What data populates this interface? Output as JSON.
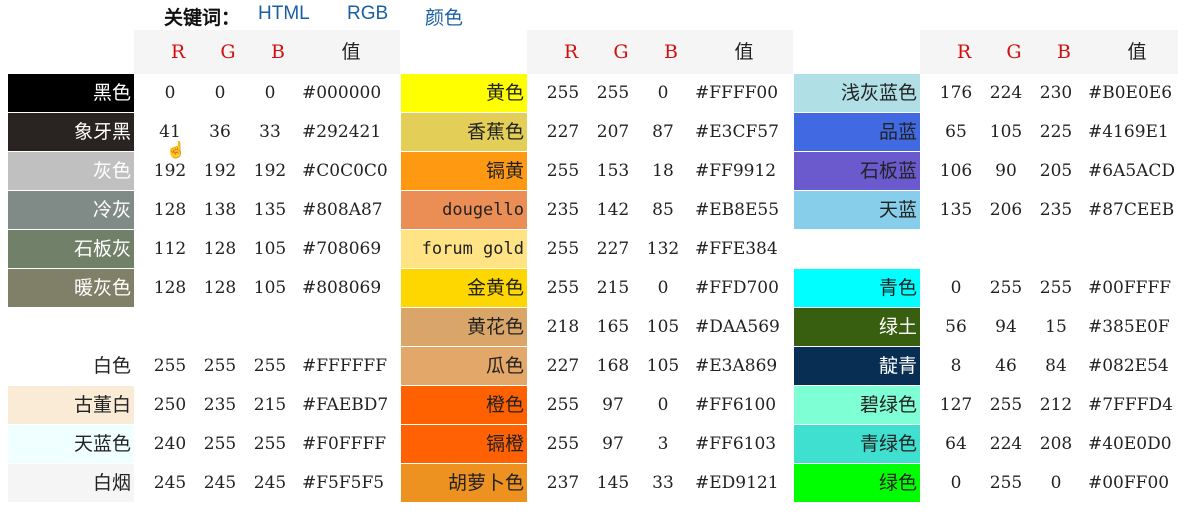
{
  "keywords": {
    "label": "关键词：",
    "links": [
      "HTML",
      "RGB",
      "颜色"
    ]
  },
  "headers": {
    "r": "R",
    "g": "G",
    "b": "B",
    "value": "值"
  },
  "panels": [
    {
      "rows": [
        {
          "name": "黑色",
          "r": "0",
          "g": "0",
          "b": "0",
          "hex": "#000000",
          "bg": "#000000",
          "fg": "#ffffff"
        },
        {
          "name": "象牙黑",
          "r": "41",
          "g": "36",
          "b": "33",
          "hex": "#292421",
          "bg": "#292421",
          "fg": "#ffffff"
        },
        {
          "name": "灰色",
          "r": "192",
          "g": "192",
          "b": "192",
          "hex": "#C0C0C0",
          "bg": "#C0C0C0",
          "fg": "#ffffff"
        },
        {
          "name": "冷灰",
          "r": "128",
          "g": "138",
          "b": "135",
          "hex": "#808A87",
          "bg": "#808A87",
          "fg": "#ffffff"
        },
        {
          "name": "石板灰",
          "r": "112",
          "g": "128",
          "b": "105",
          "hex": "#708069",
          "bg": "#708069",
          "fg": "#ffffff"
        },
        {
          "name": "暖灰色",
          "r": "128",
          "g": "128",
          "b": "105",
          "hex": "#808069",
          "bg": "#808069",
          "fg": "#ffffff"
        },
        null,
        {
          "name": "白色",
          "r": "255",
          "g": "255",
          "b": "255",
          "hex": "#FFFFFF",
          "bg": "#FFFFFF",
          "fg": "#222222"
        },
        {
          "name": "古董白",
          "r": "250",
          "g": "235",
          "b": "215",
          "hex": "#FAEBD7",
          "bg": "#FAEBD7",
          "fg": "#222222"
        },
        {
          "name": "天蓝色",
          "r": "240",
          "g": "255",
          "b": "255",
          "hex": "#F0FFFF",
          "bg": "#F0FFFF",
          "fg": "#222222"
        },
        {
          "name": "白烟",
          "r": "245",
          "g": "245",
          "b": "245",
          "hex": "#F5F5F5",
          "bg": "#F5F5F5",
          "fg": "#222222"
        }
      ]
    },
    {
      "rows": [
        {
          "name": "黄色",
          "r": "255",
          "g": "255",
          "b": "0",
          "hex": "#FFFF00",
          "bg": "#FFFF00",
          "fg": "#222222"
        },
        {
          "name": "香蕉色",
          "r": "227",
          "g": "207",
          "b": "87",
          "hex": "#E3CF57",
          "bg": "#E3CF57",
          "fg": "#222222"
        },
        {
          "name": "镉黄",
          "r": "255",
          "g": "153",
          "b": "18",
          "hex": "#FF9912",
          "bg": "#FF9912",
          "fg": "#222222"
        },
        {
          "name": "dougello",
          "r": "235",
          "g": "142",
          "b": "85",
          "hex": "#EB8E55",
          "bg": "#EB8E55",
          "fg": "#222222"
        },
        {
          "name": "forum gold",
          "r": "255",
          "g": "227",
          "b": "132",
          "hex": "#FFE384",
          "bg": "#FFE384",
          "fg": "#222222"
        },
        {
          "name": "金黄色",
          "r": "255",
          "g": "215",
          "b": "0",
          "hex": "#FFD700",
          "bg": "#FFD700",
          "fg": "#222222"
        },
        {
          "name": "黄花色",
          "r": "218",
          "g": "165",
          "b": "105",
          "hex": "#DAA569",
          "bg": "#DAA569",
          "fg": "#222222"
        },
        {
          "name": "瓜色",
          "r": "227",
          "g": "168",
          "b": "105",
          "hex": "#E3A869",
          "bg": "#E3A869",
          "fg": "#222222"
        },
        {
          "name": "橙色",
          "r": "255",
          "g": "97",
          "b": "0",
          "hex": "#FF6100",
          "bg": "#FF6100",
          "fg": "#222222"
        },
        {
          "name": "镉橙",
          "r": "255",
          "g": "97",
          "b": "3",
          "hex": "#FF6103",
          "bg": "#FF6103",
          "fg": "#222222"
        },
        {
          "name": "胡萝卜色",
          "r": "237",
          "g": "145",
          "b": "33",
          "hex": "#ED9121",
          "bg": "#ED9121",
          "fg": "#222222"
        }
      ]
    },
    {
      "rows": [
        {
          "name": "浅灰蓝色",
          "r": "176",
          "g": "224",
          "b": "230",
          "hex": "#B0E0E6",
          "bg": "#B0E0E6",
          "fg": "#222222"
        },
        {
          "name": "品蓝",
          "r": "65",
          "g": "105",
          "b": "225",
          "hex": "#4169E1",
          "bg": "#4169E1",
          "fg": "#222222"
        },
        {
          "name": "石板蓝",
          "r": "106",
          "g": "90",
          "b": "205",
          "hex": "#6A5ACD",
          "bg": "#6A5ACD",
          "fg": "#222222"
        },
        {
          "name": "天蓝",
          "r": "135",
          "g": "206",
          "b": "235",
          "hex": "#87CEEB",
          "bg": "#87CEEB",
          "fg": "#222222"
        },
        null,
        {
          "name": "青色",
          "r": "0",
          "g": "255",
          "b": "255",
          "hex": "#00FFFF",
          "bg": "#00FFFF",
          "fg": "#222222"
        },
        {
          "name": "绿土",
          "r": "56",
          "g": "94",
          "b": "15",
          "hex": "#385E0F",
          "bg": "#385E0F",
          "fg": "#ffffff"
        },
        {
          "name": "靛青",
          "r": "8",
          "g": "46",
          "b": "84",
          "hex": "#082E54",
          "bg": "#082E54",
          "fg": "#ffffff"
        },
        {
          "name": "碧绿色",
          "r": "127",
          "g": "255",
          "b": "212",
          "hex": "#7FFFD4",
          "bg": "#7FFFD4",
          "fg": "#222222"
        },
        {
          "name": "青绿色",
          "r": "64",
          "g": "224",
          "b": "208",
          "hex": "#40E0D0",
          "bg": "#40E0D0",
          "fg": "#222222"
        },
        {
          "name": "绿色",
          "r": "0",
          "g": "255",
          "b": "0",
          "hex": "#00FF00",
          "bg": "#00FF00",
          "fg": "#222222"
        }
      ]
    }
  ]
}
